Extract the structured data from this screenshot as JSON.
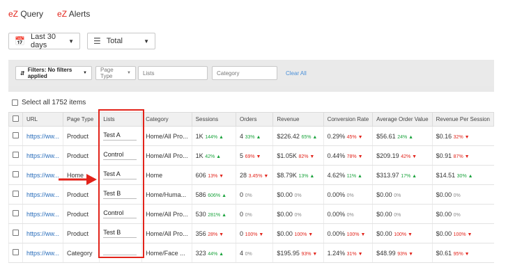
{
  "nav": {
    "tabs": [
      {
        "prefix": "eZ",
        "label": " Query"
      },
      {
        "prefix": "eZ",
        "label": " Alerts"
      }
    ]
  },
  "controls": {
    "date_range": "Last 30 days",
    "total": "Total"
  },
  "filters": {
    "filters_label": "Filters: No filters applied",
    "page_type_placeholder": "Page Type",
    "lists_placeholder": "Lists",
    "category_placeholder": "Category",
    "clear_all": "Clear All"
  },
  "select_all": "Select all 1752 items",
  "table": {
    "headers": [
      "URL",
      "Page Type",
      "Lists",
      "Category",
      "Sessions",
      "Orders",
      "Revenue",
      "Conversion Rate",
      "Average Order Value",
      "Revenue Per Session"
    ],
    "rows": [
      {
        "url": "https://ww...",
        "page_type": "Product",
        "list": "Test A",
        "category": "Home/All Pro...",
        "sessions": "1K",
        "sessions_chg": "144%",
        "sessions_dir": "up",
        "orders": "4",
        "orders_chg": "33%",
        "orders_dir": "up",
        "revenue": "$226.42",
        "revenue_chg": "65%",
        "revenue_dir": "up",
        "cr": "0.29%",
        "cr_chg": "45%",
        "cr_dir": "down",
        "aov": "$56.61",
        "aov_chg": "24%",
        "aov_dir": "up",
        "rps": "$0.16",
        "rps_chg": "32%",
        "rps_dir": "down"
      },
      {
        "url": "https://ww...",
        "page_type": "Product",
        "list": "Control",
        "category": "Home/All Pro...",
        "sessions": "1K",
        "sessions_chg": "42%",
        "sessions_dir": "up",
        "orders": "5",
        "orders_chg": "69%",
        "orders_dir": "down",
        "revenue": "$1.05K",
        "revenue_chg": "82%",
        "revenue_dir": "down",
        "cr": "0.44%",
        "cr_chg": "78%",
        "cr_dir": "down",
        "aov": "$209.19",
        "aov_chg": "42%",
        "aov_dir": "down",
        "rps": "$0.91",
        "rps_chg": "87%",
        "rps_dir": "down"
      },
      {
        "url": "https://ww...",
        "page_type": "Home",
        "list": "Test A",
        "category": "Home",
        "sessions": "606",
        "sessions_chg": "13%",
        "sessions_dir": "down",
        "orders": "28",
        "orders_chg": "3.45%",
        "orders_dir": "down",
        "revenue": "$8.79K",
        "revenue_chg": "13%",
        "revenue_dir": "up",
        "cr": "4.62%",
        "cr_chg": "11%",
        "cr_dir": "up",
        "aov": "$313.97",
        "aov_chg": "17%",
        "aov_dir": "up",
        "rps": "$14.51",
        "rps_chg": "30%",
        "rps_dir": "up"
      },
      {
        "url": "https://ww...",
        "page_type": "Product",
        "list": "Test B",
        "category": "Home/Huma...",
        "sessions": "586",
        "sessions_chg": "606%",
        "sessions_dir": "up",
        "orders": "0",
        "orders_chg": "0%",
        "orders_dir": "flat",
        "revenue": "$0.00",
        "revenue_chg": "0%",
        "revenue_dir": "flat",
        "cr": "0.00%",
        "cr_chg": "0%",
        "cr_dir": "flat",
        "aov": "$0.00",
        "aov_chg": "0%",
        "aov_dir": "flat",
        "rps": "$0.00",
        "rps_chg": "0%",
        "rps_dir": "flat"
      },
      {
        "url": "https://ww...",
        "page_type": "Product",
        "list": "Control",
        "category": "Home/All Pro...",
        "sessions": "530",
        "sessions_chg": "281%",
        "sessions_dir": "up",
        "orders": "0",
        "orders_chg": "0%",
        "orders_dir": "flat",
        "revenue": "$0.00",
        "revenue_chg": "0%",
        "revenue_dir": "flat",
        "cr": "0.00%",
        "cr_chg": "0%",
        "cr_dir": "flat",
        "aov": "$0.00",
        "aov_chg": "0%",
        "aov_dir": "flat",
        "rps": "$0.00",
        "rps_chg": "0%",
        "rps_dir": "flat"
      },
      {
        "url": "https://ww...",
        "page_type": "Product",
        "list": "Test B",
        "category": "Home/All Pro...",
        "sessions": "356",
        "sessions_chg": "28%",
        "sessions_dir": "down",
        "orders": "0",
        "orders_chg": "100%",
        "orders_dir": "down",
        "revenue": "$0.00",
        "revenue_chg": "100%",
        "revenue_dir": "down",
        "cr": "0.00%",
        "cr_chg": "100%",
        "cr_dir": "down",
        "aov": "$0.00",
        "aov_chg": "100%",
        "aov_dir": "down",
        "rps": "$0.00",
        "rps_chg": "100%",
        "rps_dir": "down"
      },
      {
        "url": "https://ww...",
        "page_type": "Category",
        "list": "",
        "category": "Home/Face ...",
        "sessions": "323",
        "sessions_chg": "44%",
        "sessions_dir": "up",
        "orders": "4",
        "orders_chg": "0%",
        "orders_dir": "flat",
        "revenue": "$195.95",
        "revenue_chg": "93%",
        "revenue_dir": "down",
        "cr": "1.24%",
        "cr_chg": "31%",
        "cr_dir": "down",
        "aov": "$48.99",
        "aov_chg": "93%",
        "aov_dir": "down",
        "rps": "$0.61",
        "rps_chg": "95%",
        "rps_dir": "down"
      }
    ]
  },
  "colors": {
    "accent": "#e2231a",
    "up": "#1aa33c",
    "down": "#e2231a",
    "link": "#2a6ebb"
  }
}
